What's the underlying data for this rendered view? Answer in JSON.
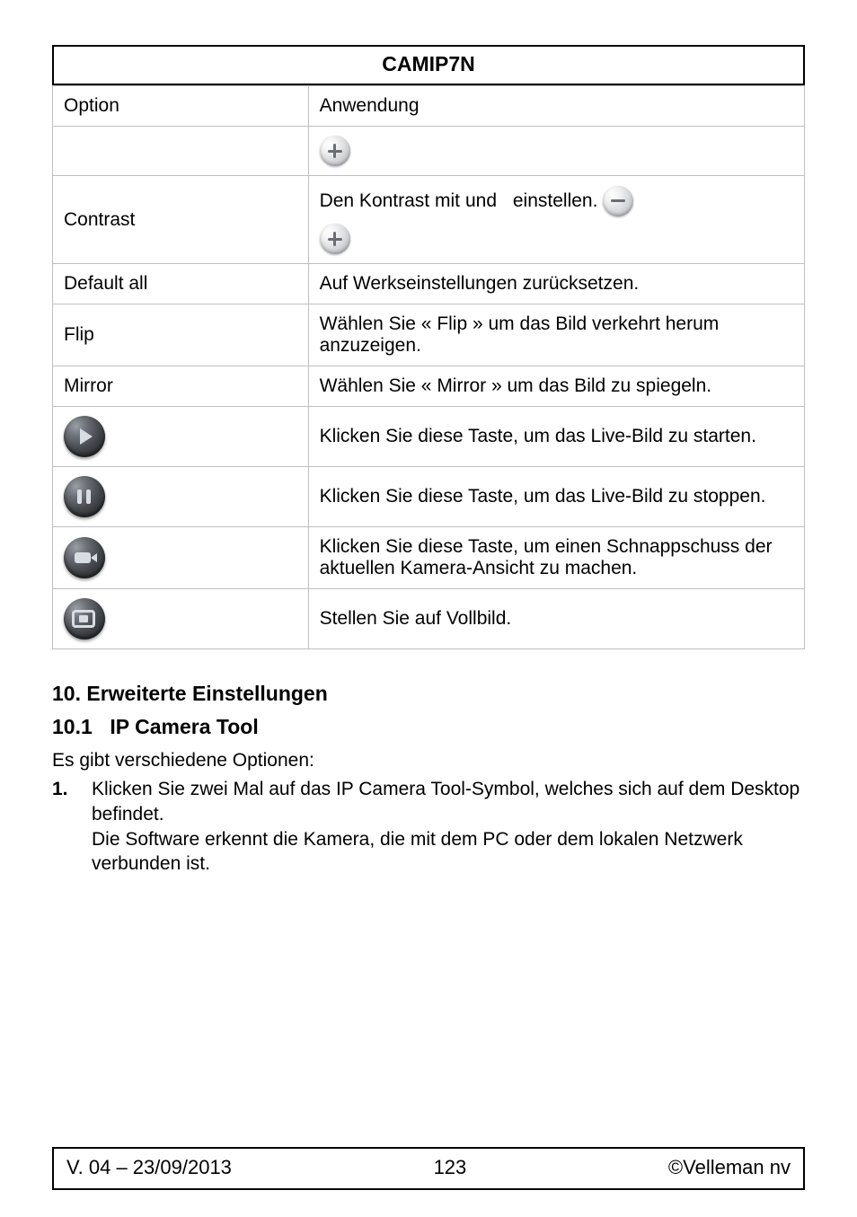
{
  "header": {
    "title": "CAMIP7N"
  },
  "table": {
    "rows": [
      {
        "option": "Option",
        "desc": "Anwendung",
        "type": "text"
      },
      {
        "option": "",
        "desc": "",
        "type": "plus-only"
      },
      {
        "option": "Contrast",
        "desc_before": "Den Kontrast mit",
        "desc_mid": "und",
        "desc_after": "einstellen.",
        "type": "contrast"
      },
      {
        "option": "Default all",
        "desc": "Auf Werkseinstellungen zurücksetzen.",
        "type": "text"
      },
      {
        "option": "Flip",
        "desc": "Wählen Sie « Flip » um das Bild verkehrt herum anzuzeigen.",
        "type": "text"
      },
      {
        "option": "Mirror",
        "desc": "Wählen Sie « Mirror » um das Bild zu spiegeln.",
        "type": "text"
      },
      {
        "option": "",
        "desc": "Klicken Sie diese Taste, um das Live-Bild zu starten.",
        "type": "icon",
        "icon": "play"
      },
      {
        "option": "",
        "desc": "Klicken Sie diese Taste, um das Live-Bild zu stoppen.",
        "type": "icon",
        "icon": "pause"
      },
      {
        "option": "",
        "desc": "Klicken Sie diese Taste, um einen Schnappschuss der aktuellen Kamera-Ansicht zu machen.",
        "type": "icon",
        "icon": "snapshot"
      },
      {
        "option": "",
        "desc": "Stellen Sie auf Vollbild.",
        "type": "icon",
        "icon": "fullscreen"
      }
    ]
  },
  "sections": {
    "s10": "10. Erweiterte Einstellungen",
    "s10_1_num": "10.1",
    "s10_1_title": "IP Camera Tool",
    "intro": "Es gibt verschiedene Optionen:",
    "step1_num": "1.",
    "step1_text": "Klicken Sie zwei Mal auf das IP Camera Tool-Symbol, welches sich auf dem Desktop befindet.\nDie Software erkennt die Kamera, die mit dem PC oder dem lokalen Netzwerk verbunden ist."
  },
  "footer": {
    "version": "V. 04 – 23/09/2013",
    "page": "123",
    "copyright": "©Velleman nv"
  }
}
